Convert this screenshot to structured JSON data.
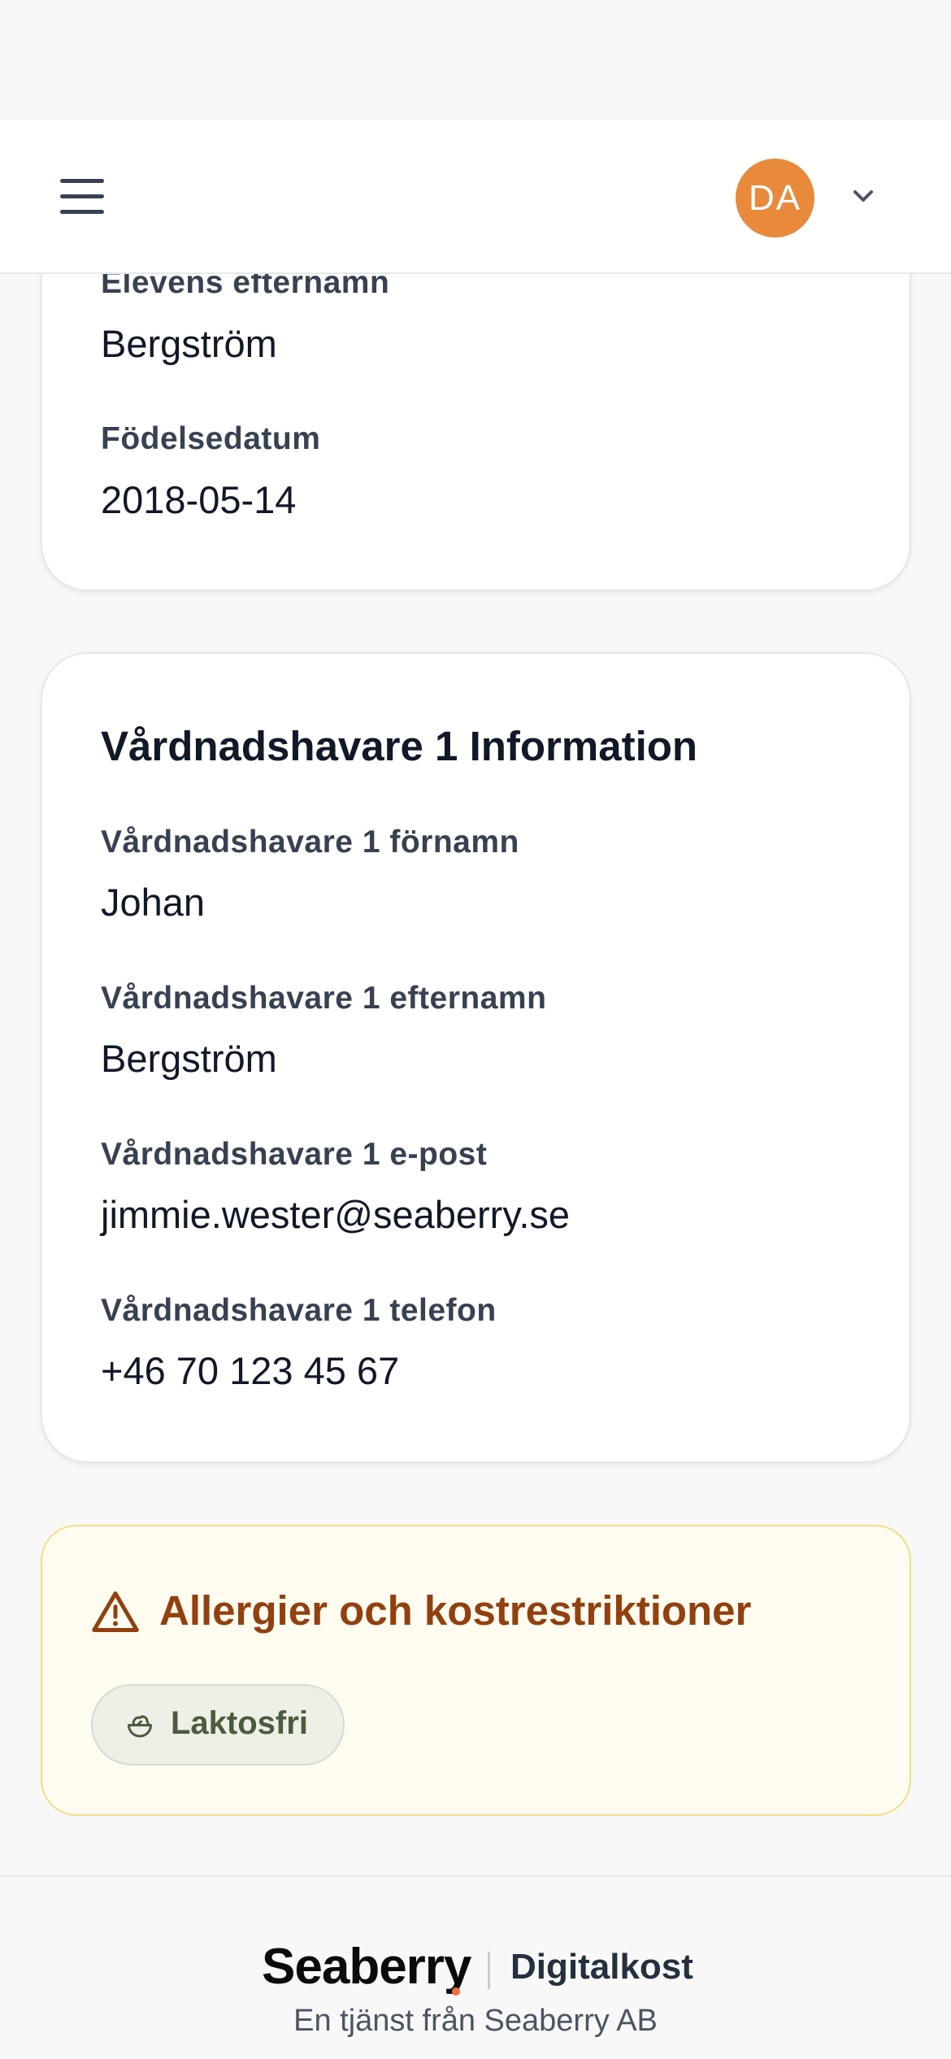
{
  "header": {
    "avatar_initials": "DA"
  },
  "student_card": {
    "fields": [
      {
        "label": "Elevens efternamn",
        "value": "Bergström"
      },
      {
        "label": "Födelsedatum",
        "value": "2018-05-14"
      }
    ]
  },
  "guardian_card": {
    "title": "Vårdnadshavare 1 Information",
    "fields": [
      {
        "label": "Vårdnadshavare 1 förnamn",
        "value": "Johan"
      },
      {
        "label": "Vårdnadshavare 1 efternamn",
        "value": "Bergström"
      },
      {
        "label": "Vårdnadshavare 1 e-post",
        "value": "jimmie.wester@seaberry.se"
      },
      {
        "label": "Vårdnadshavare 1 telefon",
        "value": "+46 70 123 45 67"
      }
    ]
  },
  "allergies": {
    "title": "Allergier och kostrestriktioner",
    "items": [
      {
        "label": "Laktosfri",
        "icon": "salad-icon"
      }
    ]
  },
  "footer": {
    "brand": "Seaberry",
    "product": "Digitalkost",
    "tagline": "En tjänst från Seaberry AB"
  },
  "colors": {
    "accent_orange": "#e8893b",
    "allergy_title": "#92400e",
    "allergy_bg": "#fefbf0",
    "allergy_border": "#f5dd85",
    "chip_bg": "#ecf0e6"
  }
}
